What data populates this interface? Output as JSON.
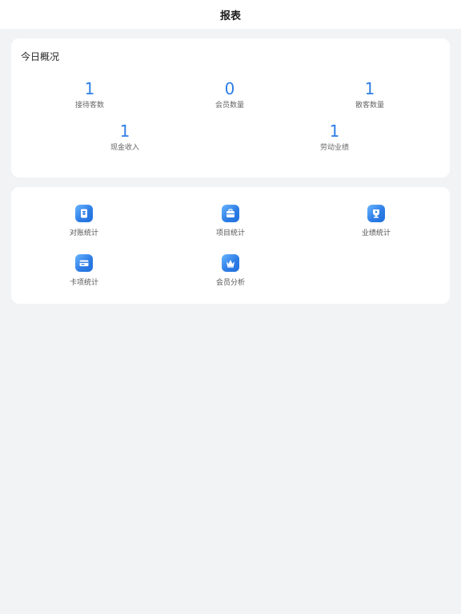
{
  "nav": {
    "title": "报表"
  },
  "overview": {
    "title": "今日概况",
    "stats": [
      {
        "value": "1",
        "label": "接待客数"
      },
      {
        "value": "0",
        "label": "会员数量"
      },
      {
        "value": "1",
        "label": "散客数量"
      },
      {
        "value": "1",
        "label": "现金收入"
      },
      {
        "value": "1",
        "label": "劳动业绩"
      }
    ]
  },
  "tools": {
    "items": [
      {
        "label": "对账统计",
        "icon": "reconcile-icon"
      },
      {
        "label": "项目统计",
        "icon": "project-icon"
      },
      {
        "label": "业绩统计",
        "icon": "performance-icon"
      },
      {
        "label": "卡项统计",
        "icon": "card-icon"
      },
      {
        "label": "会员分析",
        "icon": "member-icon"
      }
    ]
  },
  "colors": {
    "accent": "#2f7ee6",
    "background": "#f2f3f5",
    "card": "#ffffff"
  }
}
